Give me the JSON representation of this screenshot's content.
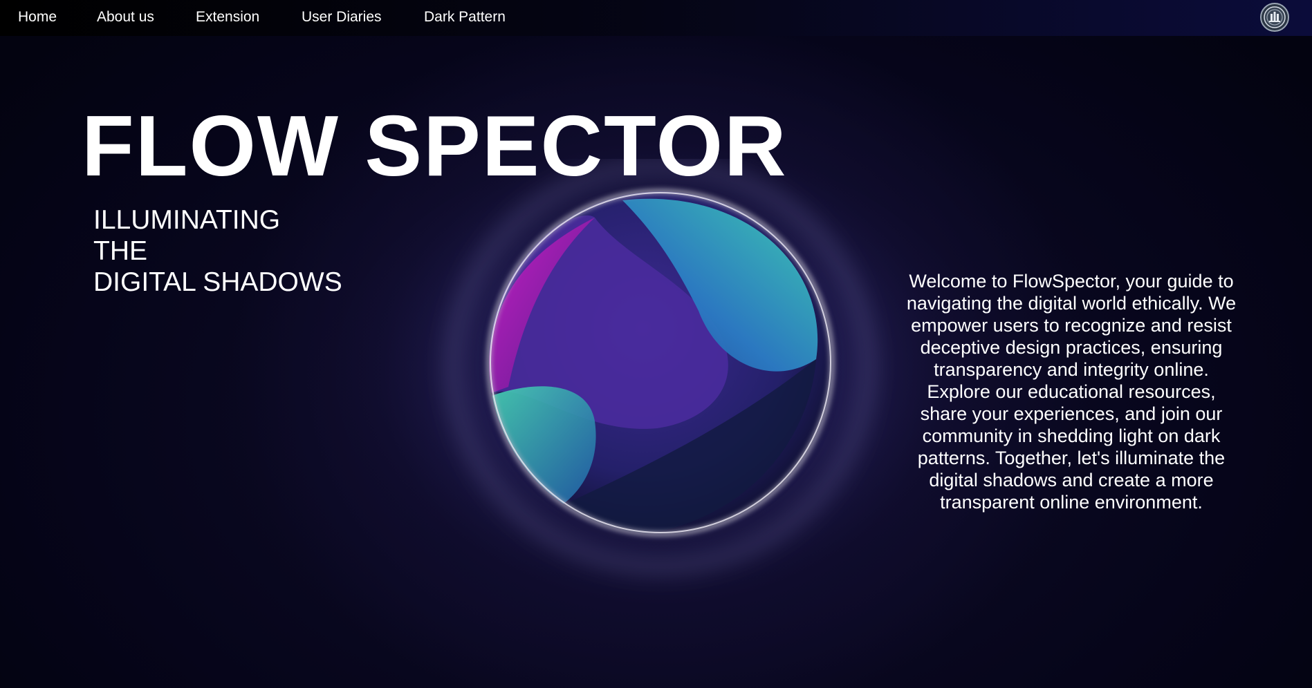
{
  "nav": {
    "items": [
      {
        "label": "Home"
      },
      {
        "label": "About us"
      },
      {
        "label": "Extension"
      },
      {
        "label": "User Diaries"
      },
      {
        "label": "Dark Pattern"
      }
    ],
    "logo_icon": "seal-logo-icon"
  },
  "hero": {
    "title": "FLOW SPECTOR",
    "subtitle_lines": [
      "ILLUMINATING",
      "THE",
      "DIGITAL SHADOWS"
    ],
    "welcome_text": "Welcome to FlowSpector, your guide to navigating the digital world ethically. We empower users to recognize and resist deceptive design practices, ensuring transparency and integrity online. Explore our educational resources, share your experiences, and join our community in shedding light on dark patterns. Together, let's illuminate the digital shadows and create a more transparent online environment."
  },
  "colors": {
    "background": "#06051a",
    "text": "#ffffff",
    "orb_magenta": "#b21fb5",
    "orb_teal": "#3fc6b8",
    "orb_blue": "#2b66b8",
    "orb_purple": "#4a2a9c"
  }
}
